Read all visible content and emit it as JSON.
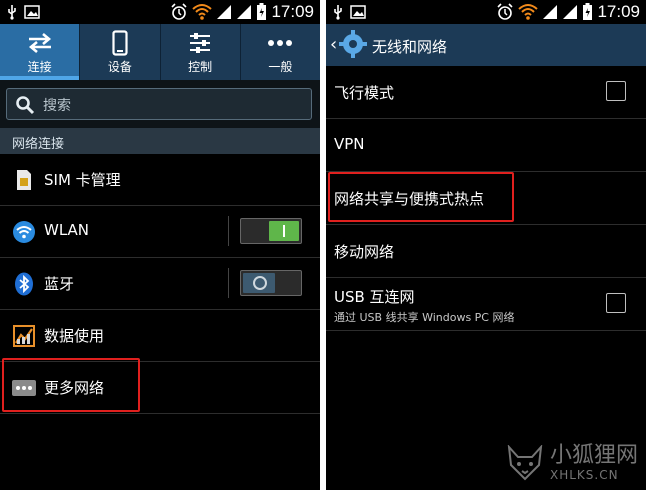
{
  "status": {
    "time": "17:09"
  },
  "left": {
    "tabs": [
      {
        "label": "连接",
        "icon": "swap-arrows-icon",
        "active": true
      },
      {
        "label": "设备",
        "icon": "phone-icon",
        "active": false
      },
      {
        "label": "控制",
        "icon": "sliders-icon",
        "active": false
      },
      {
        "label": "一般",
        "icon": "more-dots-icon",
        "active": false
      }
    ],
    "search": {
      "placeholder": "搜索"
    },
    "section_header": "网络连接",
    "items": [
      {
        "label": "SIM 卡管理",
        "icon": "sim-card-icon"
      },
      {
        "label": "WLAN",
        "icon": "wifi-icon",
        "toggle": "on"
      },
      {
        "label": "蓝牙",
        "icon": "bluetooth-icon",
        "toggle": "off"
      },
      {
        "label": "数据使用",
        "icon": "data-usage-icon"
      },
      {
        "label": "更多网络",
        "icon": "more-networks-icon"
      }
    ]
  },
  "right": {
    "title": "无线和网络",
    "items": [
      {
        "label": "飞行模式",
        "checkbox": false
      },
      {
        "label": "VPN"
      },
      {
        "label": "网络共享与便携式热点"
      },
      {
        "label": "移动网络"
      },
      {
        "label": "USB 互连网",
        "sublabel": "通过 USB 线共享 Windows PC 网络",
        "checkbox": false
      }
    ]
  },
  "watermark": {
    "cn": "小狐狸网",
    "en": "XHLKS.CN"
  },
  "colors": {
    "action_bar": "#1c3a56",
    "active_tab": "#2a6da4",
    "toggle_on": "#5fb64a",
    "highlight": "#e0201e"
  }
}
